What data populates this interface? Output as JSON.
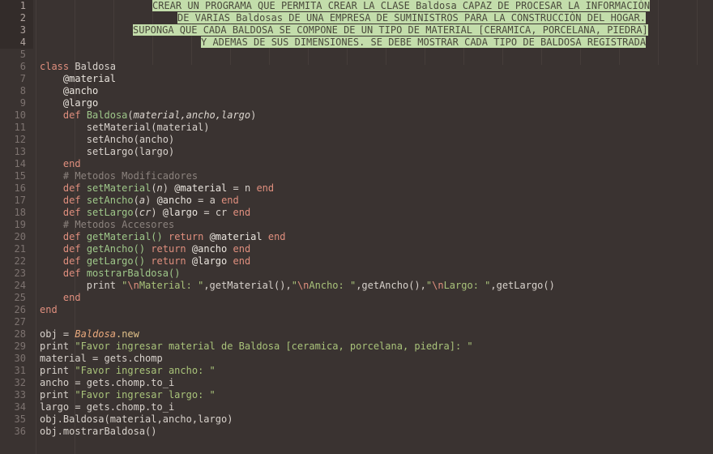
{
  "editor": {
    "language": "Ruby",
    "theme_bg": "#3a3331",
    "selection_color": "#c3ddab",
    "gutter_active_bg": "#332c2a",
    "total_lines": 36,
    "line_numbers": [
      "1",
      "2",
      "3",
      "4",
      "5",
      "6",
      "7",
      "8",
      "9",
      "10",
      "11",
      "12",
      "13",
      "14",
      "15",
      "16",
      "17",
      "18",
      "19",
      "20",
      "21",
      "22",
      "23",
      "24",
      "25",
      "26",
      "27",
      "28",
      "29",
      "30",
      "31",
      "32",
      "33",
      "34",
      "35",
      "36"
    ],
    "active_lines": [
      "1",
      "2",
      "3",
      "4"
    ]
  },
  "header_comment": {
    "line1": "CREAR UN PROGRAMA QUE PERMITA CREAR LA CLASE Baldosa CAPAZ DE PROCESAR LA INFORMACIÓN",
    "line2": "DE VARIAS Baldosas DE UNA EMPRESA DE SUMINISTROS PARA LA CONSTRUCCIÓN DEL HOGAR.",
    "line3": "SUPONGA QUE CADA BALDOSA SE COMPONE DE UN TIPO DE MATERIAL [CERAMICA, PORCELANA, PIEDRA]",
    "line4": "Y ADEMAS DE SUS DIMENSIONES. SE DEBE MOSTRAR CADA TIPO DE BALDOSA REGISTRADA"
  },
  "code": {
    "l6_class": "class",
    "l6_name": "Baldosa",
    "l7": "@material",
    "l8": "@ancho",
    "l9": "@largo",
    "l10_def": "def",
    "l10_name": "Baldosa",
    "l10_open": "(",
    "l10_params": "material,ancho,largo",
    "l10_close": ")",
    "l11": "setMaterial(material)",
    "l12": "setAncho(ancho)",
    "l13": "setLargo(largo)",
    "l14_end": "end",
    "l15_comment": "# Metodos Modificadores",
    "l16_def": "def",
    "l16_name": "setMaterial",
    "l16_param": "n",
    "l16_ivar": "@material",
    "l16_assign": "= n",
    "l16_end": "end",
    "l17_def": "def",
    "l17_name": "setAncho",
    "l17_param": "a",
    "l17_ivar": "@ancho",
    "l17_assign": "= a",
    "l17_end": "end",
    "l18_def": "def",
    "l18_name": "setLargo",
    "l18_param": "cr",
    "l18_ivar": "@largo",
    "l18_assign": "= cr",
    "l18_end": "end",
    "l19_comment": "# Metodos Accesores",
    "l20_def": "def",
    "l20_name": "getMaterial()",
    "l20_return": "return",
    "l20_ivar": "@material",
    "l20_end": "end",
    "l21_def": "def",
    "l21_name": "getAncho()",
    "l21_return": "return",
    "l21_ivar": "@ancho",
    "l21_end": "end",
    "l22_def": "def",
    "l22_name": "getLargo()",
    "l22_return": "return",
    "l22_ivar": "@largo",
    "l22_end": "end",
    "l23_def": "def",
    "l23_name": "mostrarBaldosa()",
    "l24_print": "print",
    "l24_esc1": "\\n",
    "l24_str1": "Material: \"",
    "l24_call1": ",getMaterial(),",
    "l24_q2": "\"",
    "l24_esc2": "\\n",
    "l24_str2": "Ancho: \"",
    "l24_call2": ",getAncho(),",
    "l24_q3": "\"",
    "l24_esc3": "\\n",
    "l24_str3": "Largo: \"",
    "l24_call3": ",getLargo()",
    "l25_end": "end",
    "l26_end": "end",
    "l28_obj": "obj",
    "l28_eq": "=",
    "l28_cls": "Baldosa",
    "l28_new": ".new",
    "l29_print": "print",
    "l29_str": "\"Favor ingresar material de Baldosa [ceramica, porcelana, piedra]: \"",
    "l30": "material = gets.chomp",
    "l31_print": "print",
    "l31_str": "\"Favor ingresar ancho: \"",
    "l32": "ancho = gets.chomp.to_i",
    "l33_print": "print",
    "l33_str": "\"Favor ingresar largo: \"",
    "l34": "largo = gets.chomp.to_i",
    "l35": "obj.Baldosa(material,ancho,largo)",
    "l36": "obj.mostrarBaldosa()"
  }
}
